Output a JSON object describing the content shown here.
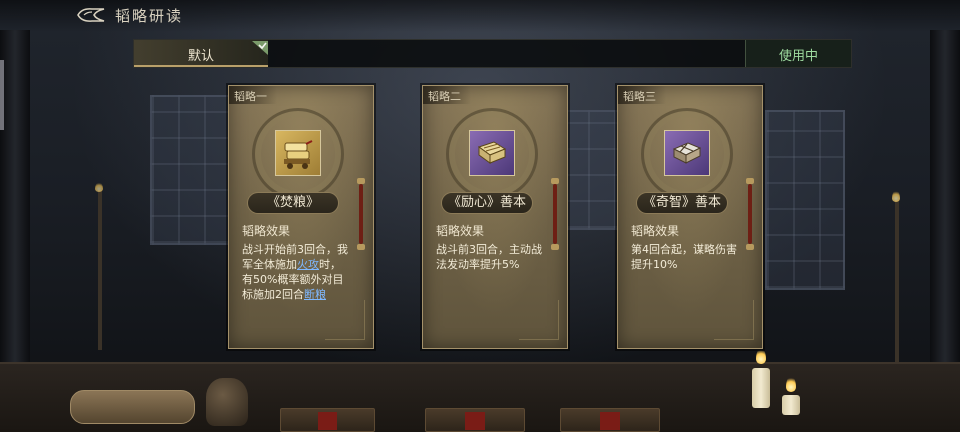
{
  "header": {
    "title": "韬略研读"
  },
  "scheme_bar": {
    "default_tab": "默认",
    "status": "使用中"
  },
  "cards": [
    {
      "tag": "韬略一",
      "name": "《焚粮》",
      "icon": "grain-cart-icon",
      "effect_title": "韬略效果",
      "effect_parts": [
        "战斗开始前3回合，我军全体施加",
        "火攻",
        "时，有50%概率额外对目标施加2回合",
        "断粮"
      ]
    },
    {
      "tag": "韬略二",
      "name": "《励心》善本",
      "icon": "scroll-book-icon",
      "effect_title": "韬略效果",
      "effect_text": "战斗前3回合，主动战法发动率提升5%"
    },
    {
      "tag": "韬略三",
      "name": "《奇智》善本",
      "icon": "bound-book-icon",
      "effect_title": "韬略效果",
      "effect_text": "第4回合起，谋略伤害提升10%"
    }
  ],
  "colors": {
    "keyword": "#7fb8ff",
    "status_green": "#9fdca0",
    "gold_border": "#b9a06a"
  }
}
